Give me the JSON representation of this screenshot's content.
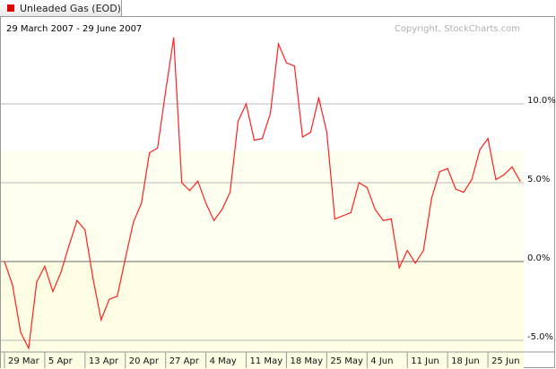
{
  "legend": {
    "label": "Unleaded Gas (EOD)",
    "color": "#e00000"
  },
  "header": {
    "date_range": "29 March 2007 - 29 June 2007",
    "copyright": "Copyright, StockCharts.com"
  },
  "colors": {
    "line": "#ff2020",
    "band_upper": "#fffff0",
    "band_lower": "#fdfde3",
    "grid": "#b8b8b8",
    "zero_line": "#6a6a6a"
  },
  "chart_data": {
    "type": "line",
    "title": "Unleaded Gas (EOD)",
    "subtitle": "29 March 2007 - 29 June 2007",
    "xlabel": "",
    "ylabel": "",
    "ylim": [
      -5.0,
      14.0
    ],
    "grid": true,
    "legend_position": "top-left",
    "yticks": [
      {
        "value": 10.0,
        "label": "10.0%"
      },
      {
        "value": 5.0,
        "label": "5.0%"
      },
      {
        "value": 0.0,
        "label": "0.0%"
      },
      {
        "value": -5.0,
        "label": "-5.0%"
      }
    ],
    "xticks": [
      {
        "index": 0,
        "label": "29 Mar"
      },
      {
        "index": 5,
        "label": "5 Apr"
      },
      {
        "index": 10,
        "label": "13 Apr"
      },
      {
        "index": 15,
        "label": "20 Apr"
      },
      {
        "index": 20,
        "label": "27 Apr"
      },
      {
        "index": 25,
        "label": "4 May"
      },
      {
        "index": 30,
        "label": "11 May"
      },
      {
        "index": 35,
        "label": "18 May"
      },
      {
        "index": 40,
        "label": "25 May"
      },
      {
        "index": 45,
        "label": "4 Jun"
      },
      {
        "index": 50,
        "label": "11 Jun"
      },
      {
        "index": 55,
        "label": "18 Jun"
      },
      {
        "index": 60,
        "label": "25 Jun"
      }
    ],
    "series": [
      {
        "values": [
          0.0,
          -1.5,
          -4.5,
          -5.5,
          -1.3,
          -0.3,
          -1.9,
          -0.7,
          1.0,
          2.6,
          2.0,
          -1.1,
          -3.7,
          -2.4,
          -2.2,
          0.2,
          2.5,
          3.7,
          6.9,
          7.2,
          10.8,
          14.2,
          5.0,
          4.5,
          5.1,
          3.7,
          2.6,
          3.3,
          4.4,
          8.9,
          10.0,
          7.7,
          7.8,
          9.4,
          13.8,
          12.6,
          12.4,
          7.9,
          8.2,
          10.4,
          8.2,
          2.7,
          2.9,
          3.1,
          5.0,
          4.7,
          3.3,
          2.6,
          2.7,
          -0.4,
          0.7,
          -0.1,
          0.7,
          4.0,
          5.7,
          5.9,
          4.6,
          4.4,
          5.2,
          7.1,
          7.8,
          5.2,
          5.5,
          6.0,
          5.1
        ]
      }
    ]
  }
}
